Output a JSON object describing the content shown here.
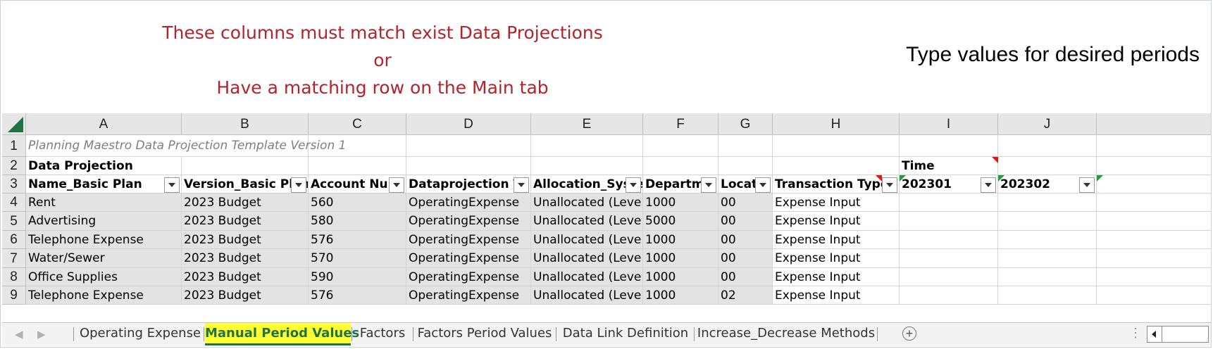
{
  "banner": {
    "red_lines": [
      "These columns must match exist Data Projections",
      "or",
      "Have a matching row on the Main tab"
    ],
    "right_note": "Type values for desired periods"
  },
  "columns": [
    "A",
    "B",
    "C",
    "D",
    "E",
    "F",
    "G",
    "H",
    "I",
    "J"
  ],
  "row_numbers": [
    "1",
    "2",
    "3",
    "4",
    "5",
    "6",
    "7",
    "8",
    "9"
  ],
  "row1": {
    "A": "Planning Maestro Data Projection Template Version 1"
  },
  "row2": {
    "A": "Data Projection",
    "I": "Time"
  },
  "headers": [
    "Name_Basic Plan",
    "Version_Basic Plan",
    "Account Num",
    "Dataprojection Ty",
    "Allocation_Syste",
    "Departme",
    "Locatio",
    "Transaction Type",
    "202301",
    "202302"
  ],
  "rows": [
    [
      "Rent",
      "2023 Budget",
      "560",
      "OperatingExpense",
      "Unallocated (Level",
      "1000",
      "00",
      "Expense Input"
    ],
    [
      "Advertising",
      "2023 Budget",
      "580",
      "OperatingExpense",
      "Unallocated (Level",
      "5000",
      "00",
      "Expense Input"
    ],
    [
      "Telephone Expense",
      "2023 Budget",
      "576",
      "OperatingExpense",
      "Unallocated (Level",
      "1000",
      "00",
      "Expense Input"
    ],
    [
      "Water/Sewer",
      "2023 Budget",
      "570",
      "OperatingExpense",
      "Unallocated (Level",
      "1000",
      "00",
      "Expense Input"
    ],
    [
      "Office Supplies",
      "2023 Budget",
      "590",
      "OperatingExpense",
      "Unallocated (Level",
      "1000",
      "00",
      "Expense Input"
    ],
    [
      "Telephone Expense",
      "2023 Budget",
      "576",
      "OperatingExpense",
      "Unallocated (Level",
      "1000",
      "02",
      "Expense Input"
    ]
  ],
  "tabs": [
    {
      "label": "Operating Expense",
      "active": false
    },
    {
      "label": "Manual Period Values",
      "active": true
    },
    {
      "label": "Factors",
      "active": false
    },
    {
      "label": "Factors Period Values",
      "active": false
    },
    {
      "label": "Data Link Definition",
      "active": false
    },
    {
      "label": "Increase_Decrease Methods",
      "active": false
    }
  ],
  "add_sheet_symbol": "+",
  "colors": {
    "red_note": "#b3232b",
    "active_tab_bg": "#ffff33",
    "excel_green": "#217346",
    "comment_marker": "#e11"
  },
  "icons": [
    "add-sheet-icon",
    "dropdown-arrow-icon",
    "scroll-left-icon"
  ]
}
